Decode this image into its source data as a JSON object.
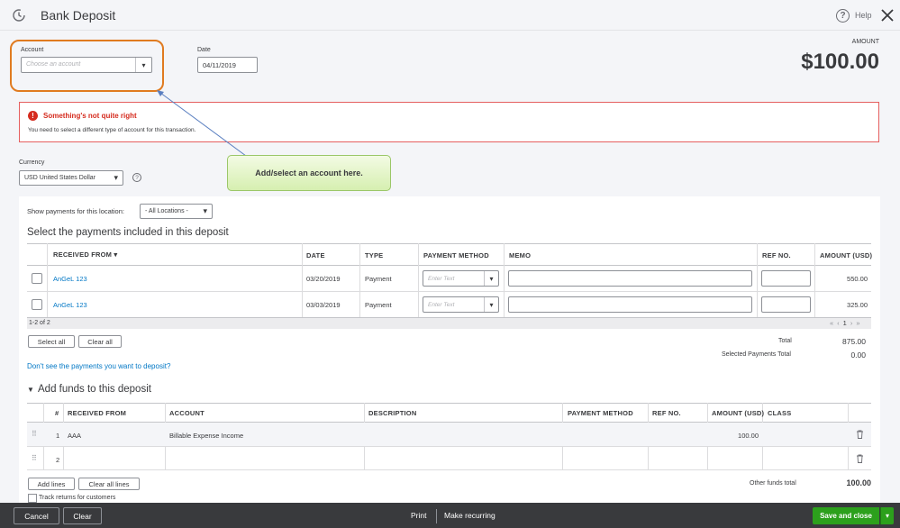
{
  "header": {
    "title": "Bank Deposit",
    "help": "Help"
  },
  "account": {
    "label": "Account",
    "placeholder": "Choose an account"
  },
  "date": {
    "label": "Date",
    "value": "04/11/2019"
  },
  "amount": {
    "label": "AMOUNT",
    "value": "$100.00"
  },
  "error": {
    "title": "Something's not quite right",
    "message": "You need to select a different type of account for this transaction."
  },
  "callout": {
    "text": "Add/select an account here."
  },
  "currency": {
    "label": "Currency",
    "value": "USD United States Dollar"
  },
  "location": {
    "label": "Show payments for this location:",
    "value": "- All Locations -"
  },
  "payments": {
    "title": "Select the payments included in this deposit",
    "columns": {
      "received_from": "RECEIVED FROM",
      "date": "DATE",
      "type": "TYPE",
      "payment_method": "PAYMENT METHOD",
      "memo": "MEMO",
      "ref_no": "REF NO.",
      "amount": "AMOUNT (USD)"
    },
    "method_placeholder": "Enter Text",
    "rows": [
      {
        "received_from": "AnGeL 123",
        "date": "03/20/2019",
        "type": "Payment",
        "amount": "550.00"
      },
      {
        "received_from": "AnGeL 123",
        "date": "03/03/2019",
        "type": "Payment",
        "amount": "325.00"
      }
    ],
    "count": "1-2 of 2",
    "pager": {
      "first": "«",
      "prev": "‹",
      "page": "1",
      "next": "›",
      "last": "»"
    },
    "select_all": "Select all",
    "clear_all": "Clear all",
    "total_label": "Total",
    "total_value": "875.00",
    "selected_label": "Selected Payments Total",
    "selected_value": "0.00",
    "missing_link": "Don't see the payments you want to deposit?"
  },
  "funds": {
    "title": "Add funds to this deposit",
    "columns": {
      "num": "#",
      "received_from": "RECEIVED FROM",
      "account": "ACCOUNT",
      "description": "DESCRIPTION",
      "payment_method": "PAYMENT METHOD",
      "ref_no": "REF NO.",
      "amount": "AMOUNT (USD)",
      "class": "CLASS"
    },
    "rows": [
      {
        "num": "1",
        "received_from": "AAA",
        "account": "Billable Expense Income",
        "amount": "100.00"
      },
      {
        "num": "2",
        "received_from": "",
        "account": "",
        "amount": ""
      }
    ],
    "add_lines": "Add lines",
    "clear_all_lines": "Clear all lines",
    "other_total_label": "Other funds total",
    "other_total_value": "100.00",
    "track_returns": "Track returns for customers"
  },
  "footer": {
    "cancel": "Cancel",
    "clear": "Clear",
    "print": "Print",
    "make_recurring": "Make recurring",
    "save_close": "Save and close"
  },
  "colors": {
    "accent": "#2ca01c",
    "error": "#d52b1e",
    "link": "#0077c5",
    "footer": "#393a3d",
    "highlight": "#e07b20"
  }
}
